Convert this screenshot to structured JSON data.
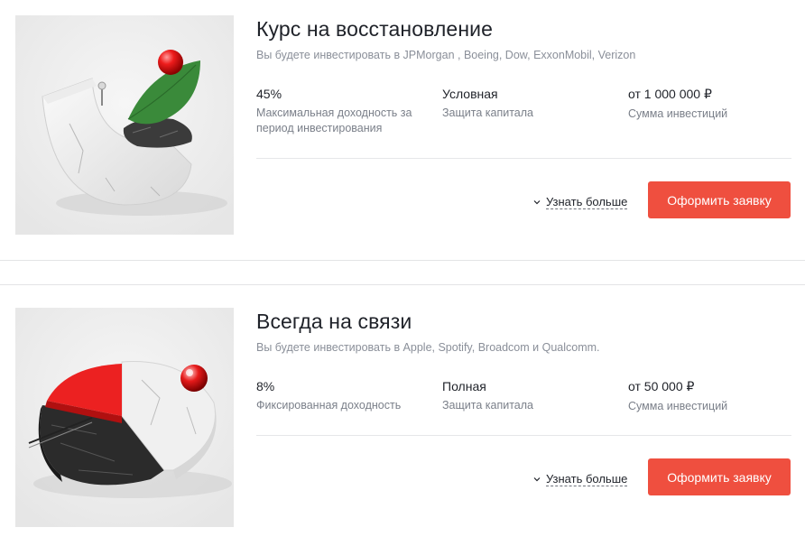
{
  "products": [
    {
      "title": "Курс на восстановление",
      "subtitle": "Вы будете инвестировать в JPMorgan , Boeing, Dow, ExxonMobil, Verizon",
      "metrics": [
        {
          "value": "45%",
          "label": "Максимальная доходность за период инвестирования"
        },
        {
          "value": "Условная",
          "label": "Защита капитала"
        },
        {
          "value": "от 1 000 000 ₽",
          "label": "Сумма инвестиций"
        }
      ],
      "more_label": "Узнать больше",
      "apply_label": "Оформить заявку",
      "image_icon": "marble-arch-leaf-sphere"
    },
    {
      "title": "Всегда на связи",
      "subtitle": "Вы будете инвестировать в Apple, Spotify, Broadcom и Qualcomm.",
      "metrics": [
        {
          "value": "8%",
          "label": "Фиксированная доходность"
        },
        {
          "value": "Полная",
          "label": "Защита капитала"
        },
        {
          "value": "от 50 000 ₽",
          "label": "Сумма инвестиций"
        }
      ],
      "more_label": "Узнать больше",
      "apply_label": "Оформить заявку",
      "image_icon": "marble-pie-chart-sphere"
    }
  ],
  "colors": {
    "accent": "#ef4f3f",
    "text": "#1f2229",
    "muted": "#8a8f99"
  }
}
